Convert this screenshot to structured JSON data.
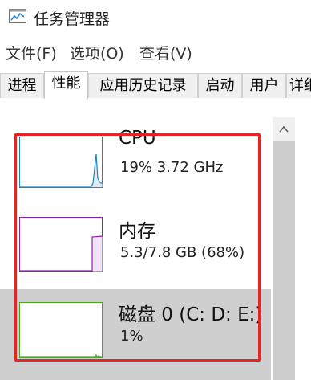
{
  "window": {
    "title": "任务管理器"
  },
  "menu": [
    "文件(F)",
    "选项(O)",
    "查看(V)"
  ],
  "tabs": [
    "进程",
    "性能",
    "应用历史记录",
    "启动",
    "用户",
    "详细"
  ],
  "active_tab": "性能",
  "performance_items": [
    {
      "name": "CPU",
      "stat": "19%  3.72 GHz",
      "color": "#1f83bd",
      "selected": false
    },
    {
      "name": "内存",
      "stat": "5.3/7.8 GB (68%)",
      "color": "#8b22a8",
      "selected": false
    },
    {
      "name": "磁盘 0 (C: D: E:)",
      "stat": "1%",
      "color": "#4aa81f",
      "selected": true
    }
  ],
  "memory_usage_fraction": 0.68,
  "cpu_usage_fraction": 0.19,
  "disk_usage_fraction": 0.01,
  "highlight_color": "#e52424"
}
